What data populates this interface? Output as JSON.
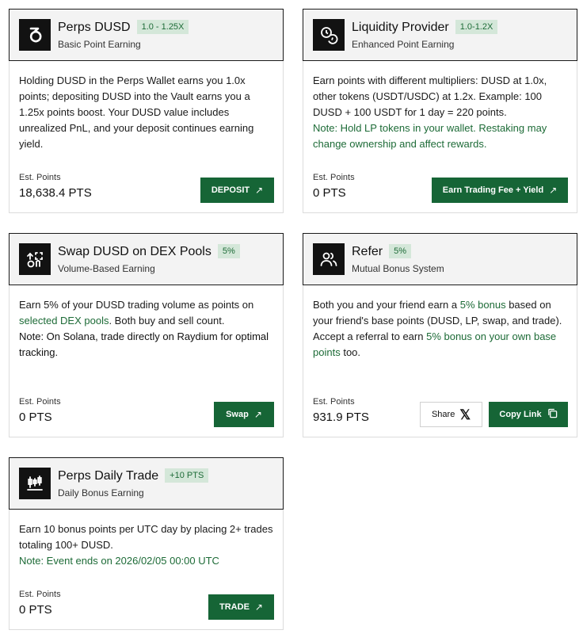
{
  "cards": {
    "perps": {
      "title": "Perps DUSD",
      "badge": "1.0 - 1.25X",
      "subtitle": "Basic Point Earning",
      "body": "Holding DUSD in the Perps Wallet earns you 1.0x points; depositing DUSD into the Vault earns you a 1.25x points boost. Your DUSD value includes unrealized PnL, and your deposit continues earning yield.",
      "est_label": "Est. Points",
      "est_value": "18,638.4 PTS",
      "button": "DEPOSIT",
      "icon": "dusd-logo-icon"
    },
    "liquidity": {
      "title": "Liquidity Provider",
      "badge": "1.0-1.2X",
      "subtitle": "Enhanced Point Earning",
      "body": "Earn points with different multipliers: DUSD at 1.0x, other tokens (USDT/USDC) at 1.2x. Example: 100 DUSD + 100 USDT for 1 day = 220 points.",
      "note": "Note: Hold LP tokens in your wallet. Restaking may change ownership and affect rewards.",
      "est_label": "Est. Points",
      "est_value": "0 PTS",
      "button": "Earn Trading Fee + Yield",
      "icon": "coins-icon"
    },
    "swap": {
      "title": "Swap DUSD on DEX Pools",
      "badge": "5%",
      "subtitle": "Volume-Based Earning",
      "body_pre": "Earn 5% of your DUSD trading volume as points on",
      "body_link": "selected DEX pools",
      "body_post": ". Both buy and sell count.",
      "note": "Note: On Solana, trade directly on Raydium for optimal tracking.",
      "est_label": "Est. Points",
      "est_value": "0 PTS",
      "button": "Swap",
      "icon": "swap-icon"
    },
    "refer": {
      "title": "Refer",
      "badge": "5%",
      "subtitle": "Mutual Bonus System",
      "body_pre": "Both you and your friend earn a",
      "body_link": "5% bonus",
      "body_post": "based on your friend's base points (DUSD, LP, swap, and trade).",
      "body2_pre": "Accept a referral to earn",
      "body2_link": "5% bonus on your own base points",
      "body2_post": "too.",
      "est_label": "Est. Points",
      "est_value": "931.9 PTS",
      "share_button": "Share",
      "copy_button": "Copy Link",
      "icon": "users-icon"
    },
    "daily": {
      "title": "Perps Daily Trade",
      "badge": "+10 PTS",
      "subtitle": "Daily Bonus Earning",
      "body": "Earn 10 bonus points per UTC day by placing 2+ trades totaling 100+ DUSD.",
      "note": "Note: Event ends on 2026/02/05 00:00 UTC",
      "est_label": "Est. Points",
      "est_value": "0 PTS",
      "button": "TRADE",
      "icon": "candlestick-icon"
    }
  },
  "colors": {
    "accent": "#166536",
    "badge_bg": "#d4e7d9",
    "badge_text": "#1d6b37",
    "header_bg": "#f3f3f3"
  }
}
